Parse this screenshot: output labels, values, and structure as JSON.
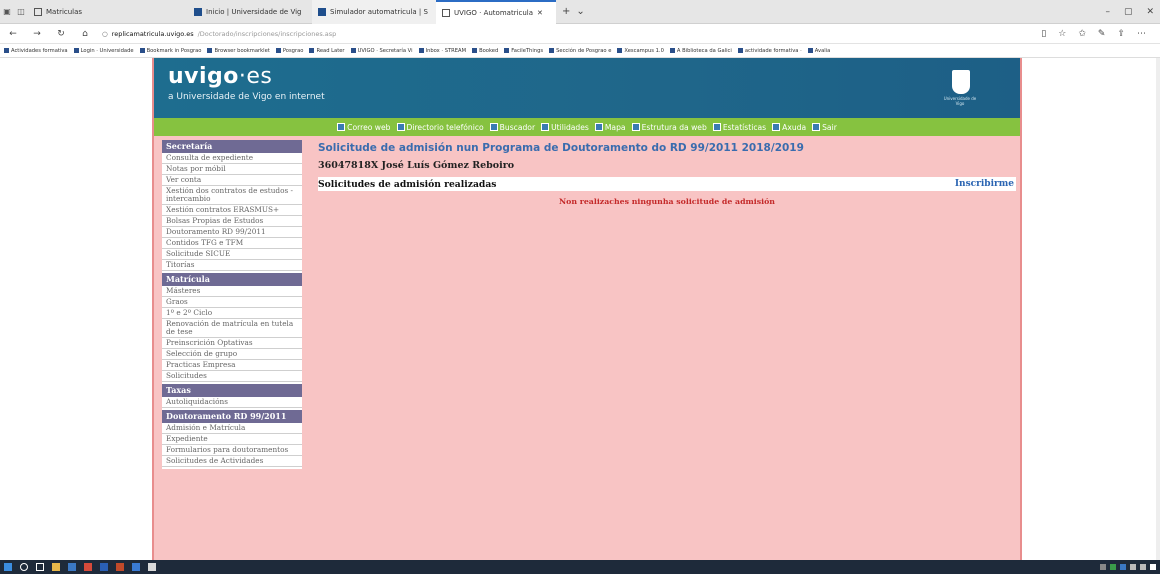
{
  "browser": {
    "tabs": [
      {
        "label": "Matriculas"
      },
      {
        "label": "Inicio | Universidade de Vig"
      },
      {
        "label": "Simulador automatricula | S"
      },
      {
        "label": "UVIGO · Automatricula"
      }
    ],
    "url_host": "replicamatricula.uvigo.es",
    "url_path": "/Doctorado/inscripciones/inscripciones.asp",
    "favorites": [
      "Actividades formativa",
      "Login · Universidade",
      "Bookmark in Posgrao",
      "Browser bookmarklet",
      "Posgrao",
      "Read Later",
      "UVIGO · Secretaría Vi",
      "Inbox · STREAM",
      "Booked",
      "FacileThings",
      "Sección de Posgrao e",
      "Xescampus 1.0",
      "A Biblioteca da Galici",
      "actividade formativa ·",
      "Avalia"
    ]
  },
  "banner": {
    "logo_main": "uvigo",
    "logo_ext": "·es",
    "tagline": "a Universidade de Vigo en internet",
    "seal_text": "Universidade de Vigo"
  },
  "topnav": [
    "Correo web",
    "Directorio telefónico",
    "Buscador",
    "Utilidades",
    "Mapa",
    "Estrutura da web",
    "Estatísticas",
    "Axuda",
    "Sair"
  ],
  "sidebar": {
    "groups": [
      {
        "title": "Secretaría",
        "items": [
          "Consulta de expediente",
          "Notas por móbil",
          "Ver conta",
          "Xestión dos contratos de estudos - intercambio",
          "Xestión contratos ERASMUS+",
          "Bolsas Propias de Estudos",
          "Doutoramento RD 99/2011",
          "Contidos TFG e TFM",
          "Solicitude SICUE",
          "Titorías"
        ]
      },
      {
        "title": "Matrícula",
        "items": [
          "Másteres",
          "Graos",
          "1º e 2º Ciclo",
          "Renovación de matrícula en tutela de tese",
          "Preinscrición Optativas",
          "Selección de grupo",
          "Practicas Empresa",
          "Solicitudes"
        ]
      },
      {
        "title": "Taxas",
        "items": [
          "Autoliquidacións"
        ]
      },
      {
        "title": "Doutoramento RD 99/2011",
        "items": [
          "Admisión e Matrícula",
          "Expediente",
          "Formularios para doutoramentos",
          "Solicitudes de Actividades"
        ]
      }
    ]
  },
  "main": {
    "title": "Solicitude de admisión nun Programa de Doutoramento do RD 99/2011 2018/2019",
    "student": "36047818X José Luís Gómez Reboiro",
    "section_header": "Solicitudes de admisión realizadas",
    "action_link": "Inscribirme",
    "empty_message": "Non realizaches ningunha solicitude de admisión"
  },
  "colors": {
    "banner": "#1f6b8e",
    "nav_green": "#86c240",
    "page_bg": "#f8c4c4",
    "sidebar_header": "#6f6a94",
    "title_blue": "#3a6cae",
    "error_red": "#c42a2a"
  }
}
